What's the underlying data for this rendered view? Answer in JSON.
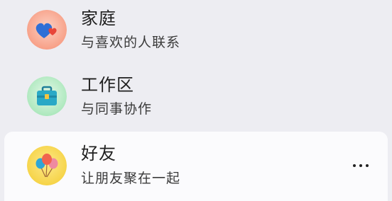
{
  "communities": [
    {
      "name": "家庭",
      "description": "与喜欢的人联系",
      "icon": "heart-icon",
      "color": "#f7a48c"
    },
    {
      "name": "工作区",
      "description": "与同事协作",
      "icon": "briefcase-icon",
      "color": "#b9ecc6"
    },
    {
      "name": "好友",
      "description": "让朋友聚在一起",
      "icon": "balloons-icon",
      "color": "#f7d64a",
      "selected": true
    }
  ],
  "more_options": {
    "icon": "more-horizontal-icon"
  }
}
